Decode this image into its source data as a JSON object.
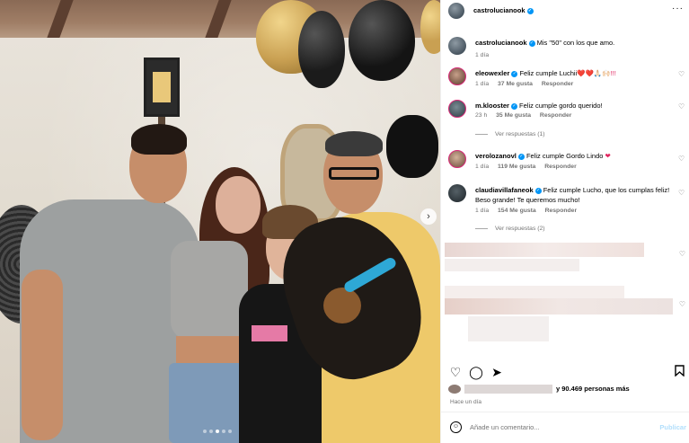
{
  "post": {
    "author": "castrolucianook",
    "more_icon": "more-dots-icon",
    "caption": "Mis \"50\" con los que amo.",
    "caption_time": "1 día"
  },
  "comments": [
    {
      "user": "eleowexler",
      "text": "Feliz cumple Luchii",
      "emoji": "❤️❤️🙏🏻🙌🏻!!!",
      "time": "1 día",
      "likes": "37 Me gusta",
      "reply": "Responder"
    },
    {
      "user": "m.klooster",
      "text": "Feliz cumple gordo querido!",
      "time": "23 h",
      "likes": "35 Me gusta",
      "reply": "Responder",
      "view_replies": "Ver respuestas (1)"
    },
    {
      "user": "verolozanovl",
      "text": "Feliz cumple Gordo Lindo",
      "emoji": "❤",
      "time": "1 día",
      "likes": "119 Me gusta",
      "reply": "Responder"
    },
    {
      "user": "claudiavillafaneok",
      "text": "Feliz cumple Lucho, que los cumplas feliz! Beso grande! Te queremos mucho!",
      "time": "1 día",
      "likes": "154 Me gusta",
      "reply": "Responder",
      "view_replies": "Ver respuestas (2)"
    }
  ],
  "actions": {
    "like_icon": "heart-outline-icon",
    "comment_icon": "comment-icon",
    "share_icon": "send-icon",
    "save_icon": "bookmark-icon"
  },
  "likes_text": "y 90.469 personas más",
  "post_time": "Hace un día",
  "comment_input": {
    "placeholder": "Añade un comentario...",
    "publish_label": "Publicar"
  },
  "photo": {
    "next_icon": "chevron-right-icon",
    "slide_count": 5,
    "current_slide": 3
  },
  "colors": {
    "verified": "#0095f6",
    "muted_text": "#737373",
    "heart_red": "#e0245e",
    "publish_disabled": "#b2dffc"
  }
}
